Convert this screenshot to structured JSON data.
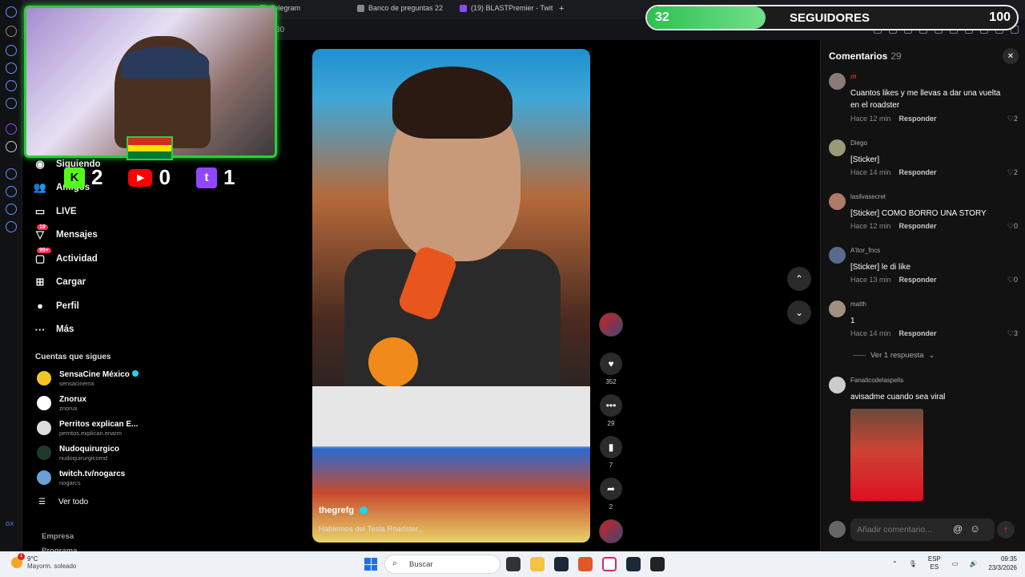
{
  "browser": {
    "tabs": [
      {
        "label": "Telegram"
      },
      {
        "label": "Banco de preguntas 22"
      },
      {
        "label": "(19) BLASTPremier - Twit"
      }
    ],
    "address_fragment": "30"
  },
  "sidebar": {
    "items": [
      {
        "label": "Siguiendo",
        "icon": "following-icon"
      },
      {
        "label": "Amigos",
        "icon": "friends-icon"
      },
      {
        "label": "LIVE",
        "icon": "live-icon"
      },
      {
        "label": "Mensajes",
        "icon": "messages-icon",
        "badge": "19"
      },
      {
        "label": "Actividad",
        "icon": "activity-icon",
        "badge": "99+"
      },
      {
        "label": "Cargar",
        "icon": "upload-icon"
      },
      {
        "label": "Perfil",
        "icon": "profile-icon"
      },
      {
        "label": "Más",
        "icon": "more-icon"
      }
    ],
    "following_header": "Cuentas que sigues",
    "accounts": [
      {
        "name": "SensaCine México",
        "handle": "sensacinemx",
        "verified": true
      },
      {
        "name": "Znorux",
        "handle": "znorux",
        "verified": false
      },
      {
        "name": "Perritos explican E...",
        "handle": "perritos.explican.enarm",
        "verified": false
      },
      {
        "name": "Nudoquirurgico",
        "handle": "nudoquirurgicomd",
        "verified": false
      },
      {
        "name": "twitch.tv/nogarcs",
        "handle": "nogarcs",
        "verified": false
      }
    ],
    "see_all": "Ver todo",
    "footer": [
      "Empresa",
      "Programa"
    ]
  },
  "video": {
    "username": "thegrefg",
    "description": "Hablemos del Tesla Roadster..."
  },
  "actions": {
    "likes": "352",
    "comments": "29",
    "saves": "7",
    "shares": "2"
  },
  "comments_panel": {
    "title": "Comentarios",
    "count": "29",
    "reply_label": "Responder",
    "items": [
      {
        "name": "𝒎",
        "text": "Cuantos likes y me llevas a dar una vuelta en el roadster",
        "time": "Hace 12 min",
        "likes": "2"
      },
      {
        "name": "Diego",
        "text": "[Sticker]",
        "time": "Hace 14 min",
        "likes": "2"
      },
      {
        "name": "lasilvasecret",
        "text": "[Sticker] COMO BORRO UNA STORY",
        "time": "Hace 12 min",
        "likes": "0"
      },
      {
        "name": "A'itor_fncs",
        "text": "[Sticker] le di like",
        "time": "Hace 13 min",
        "likes": "0"
      },
      {
        "name": "matth",
        "text": "1",
        "time": "Hace 14 min",
        "likes": "3"
      },
      {
        "name": "Fanaticodelaspelis",
        "text": "avisadme cuando sea viral",
        "time": "",
        "likes": ""
      }
    ],
    "view_replies": "Ver 1 respuesta",
    "input_placeholder": "Añadir comentario..."
  },
  "stream_overlay": {
    "kick_count": "2",
    "youtube_count": "0",
    "twitch_count": "1",
    "follower_goal_label": "SEGUIDORES",
    "follower_current": "32",
    "follower_goal": "100",
    "follower_progress": 0.32,
    "colors": {
      "accent": "#2ecc40",
      "kick": "#53fc18",
      "youtube": "#ff0000",
      "twitch": "#9146ff"
    }
  },
  "taskbar": {
    "weather_temp": "9°C",
    "weather_desc": "Mayorm. soleado",
    "weather_badge": "1",
    "search_placeholder": "Buscar",
    "lang_top": "ESP",
    "lang_bottom": "ES",
    "time": "09:35",
    "date": "23/3/2026"
  },
  "colors": {
    "tiktok_accent": "#fe2c55",
    "verified": "#20d5ec"
  }
}
